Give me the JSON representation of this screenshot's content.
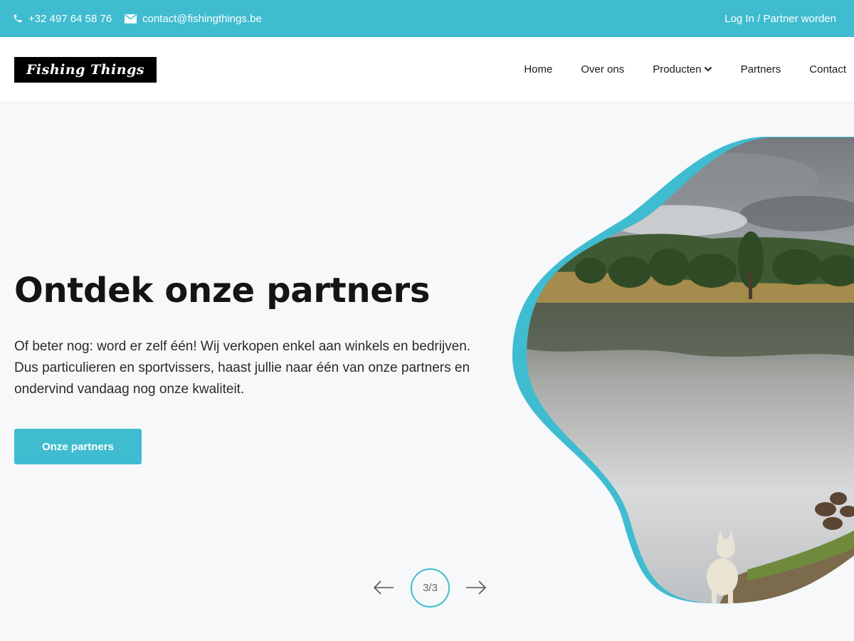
{
  "topbar": {
    "phone": "+32 497 64 58 76",
    "email": "contact@fishingthings.be",
    "login": "Log In / Partner worden"
  },
  "header": {
    "logo_text": "Fishing Things",
    "nav": [
      {
        "label": "Home"
      },
      {
        "label": "Over ons"
      },
      {
        "label": "Producten"
      },
      {
        "label": "Partners"
      },
      {
        "label": "Contact"
      }
    ]
  },
  "hero": {
    "title": "Ontdek onze partners",
    "text": "Of beter nog: word er zelf één! Wij verkopen enkel aan winkels en bedrijven. Dus particulieren en sportvissers, haast jullie naar één van onze partners en ondervind vandaag nog onze kwaliteit.",
    "button": "Onze partners"
  },
  "slider": {
    "counter": "3/3"
  },
  "colors": {
    "accent": "#3fbcd0"
  },
  "icons": {
    "phone": "phone-icon",
    "mail": "mail-icon",
    "dropdown": "chevron-down-icon",
    "prev": "arrow-left-icon",
    "next": "arrow-right-icon"
  }
}
